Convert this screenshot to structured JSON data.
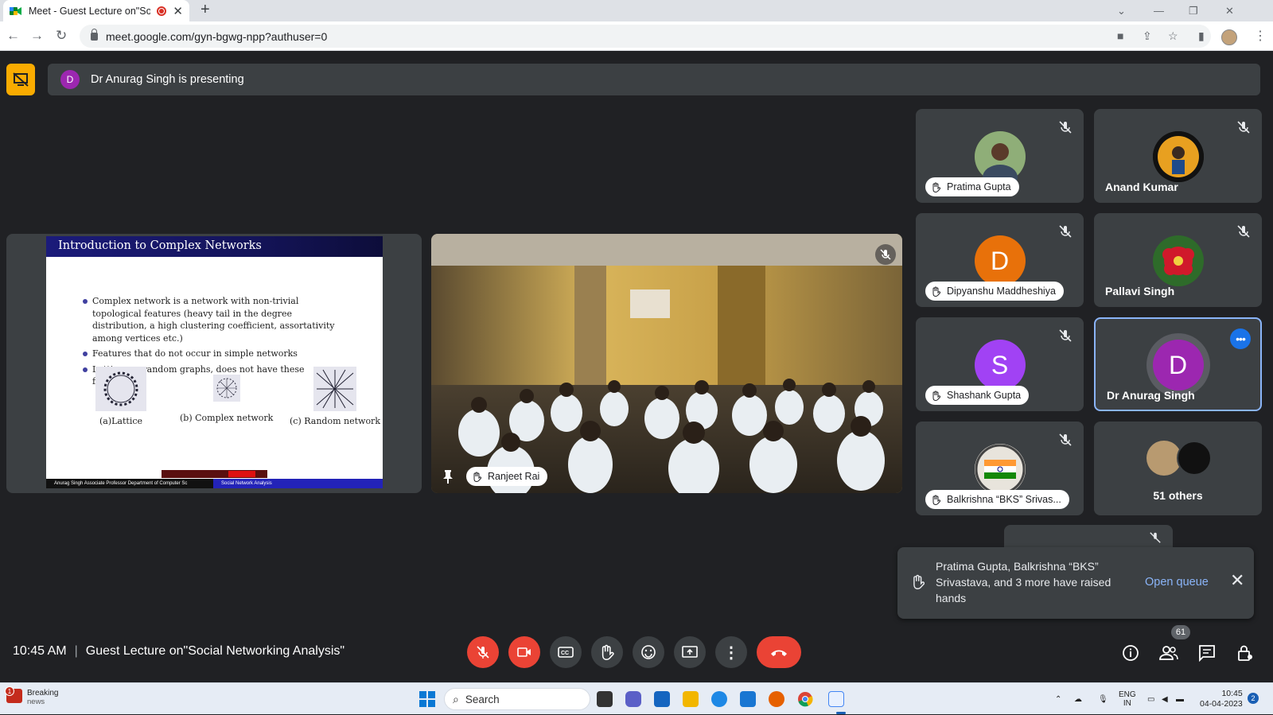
{
  "browser": {
    "tab_title": "Meet - Guest Lecture on\"Soc",
    "url": "meet.google.com/gyn-bgwg-npp?authuser=0"
  },
  "presenting": {
    "avatar_letter": "D",
    "text": "Dr Anurag Singh is presenting"
  },
  "slide": {
    "title": "Introduction to Complex Networks",
    "bullets": [
      "Complex network is a network with non-trivial topological features (heavy tail in the degree distribution, a high clustering coefficient, assortativity among vertices etc.)",
      "Features that do not occur in simple networks",
      "Lattices or random graphs, does not have these features."
    ],
    "figures": [
      "(a)Lattice",
      "(b) Complex network",
      "(c) Random network"
    ],
    "footer_left": "Anurag Singh Associate Professor Department of Computer Sc",
    "footer_right": "Social Network Analysis"
  },
  "camera": {
    "name": "Ranjeet Rai"
  },
  "participants": [
    {
      "name": "Pratima Gupta",
      "hand_raised": true,
      "muted": true,
      "avatar": "photo",
      "color": "#4a6b3a"
    },
    {
      "name": "Anand Kumar",
      "hand_raised": false,
      "muted": true,
      "avatar": "photo",
      "color": "#e8a020"
    },
    {
      "name": "Dipyanshu Maddheshiya",
      "hand_raised": true,
      "muted": true,
      "letter": "D",
      "color": "#e8710a"
    },
    {
      "name": "Pallavi Singh",
      "hand_raised": false,
      "muted": true,
      "avatar": "photo",
      "color": "#c2185b"
    },
    {
      "name": "Shashank Gupta",
      "hand_raised": true,
      "muted": true,
      "letter": "S",
      "color": "#a142f4"
    },
    {
      "name": "Dr Anurag Singh",
      "hand_raised": false,
      "muted": false,
      "letter": "D",
      "color": "#9c27b0",
      "active": true
    },
    {
      "name": "Balkrishna “BKS” Srivas...",
      "hand_raised": true,
      "muted": true,
      "avatar": "flag"
    }
  ],
  "others": {
    "label": "51 others"
  },
  "hand_toast": {
    "text": "Pratima Gupta, Balkrishna “BKS” Srivastava, and 3 more have raised hands",
    "action": "Open queue"
  },
  "meeting": {
    "time": "10:45 AM",
    "title": "Guest Lecture on\"Social Networking Analysis\"",
    "participant_count": "61"
  },
  "taskbar": {
    "news_title": "Breaking",
    "news_sub": "news",
    "news_badge": "1",
    "search_label": "Search",
    "lang_top": "ENG",
    "lang_bottom": "IN",
    "clock_time": "10:45",
    "clock_date": "04-04-2023",
    "notif_count": "2"
  },
  "colors": {
    "meet_bg": "#202124",
    "tile_bg": "#3c4043",
    "danger": "#ea4335",
    "accent": "#8ab4f8",
    "present_stop": "#f9ab00"
  }
}
